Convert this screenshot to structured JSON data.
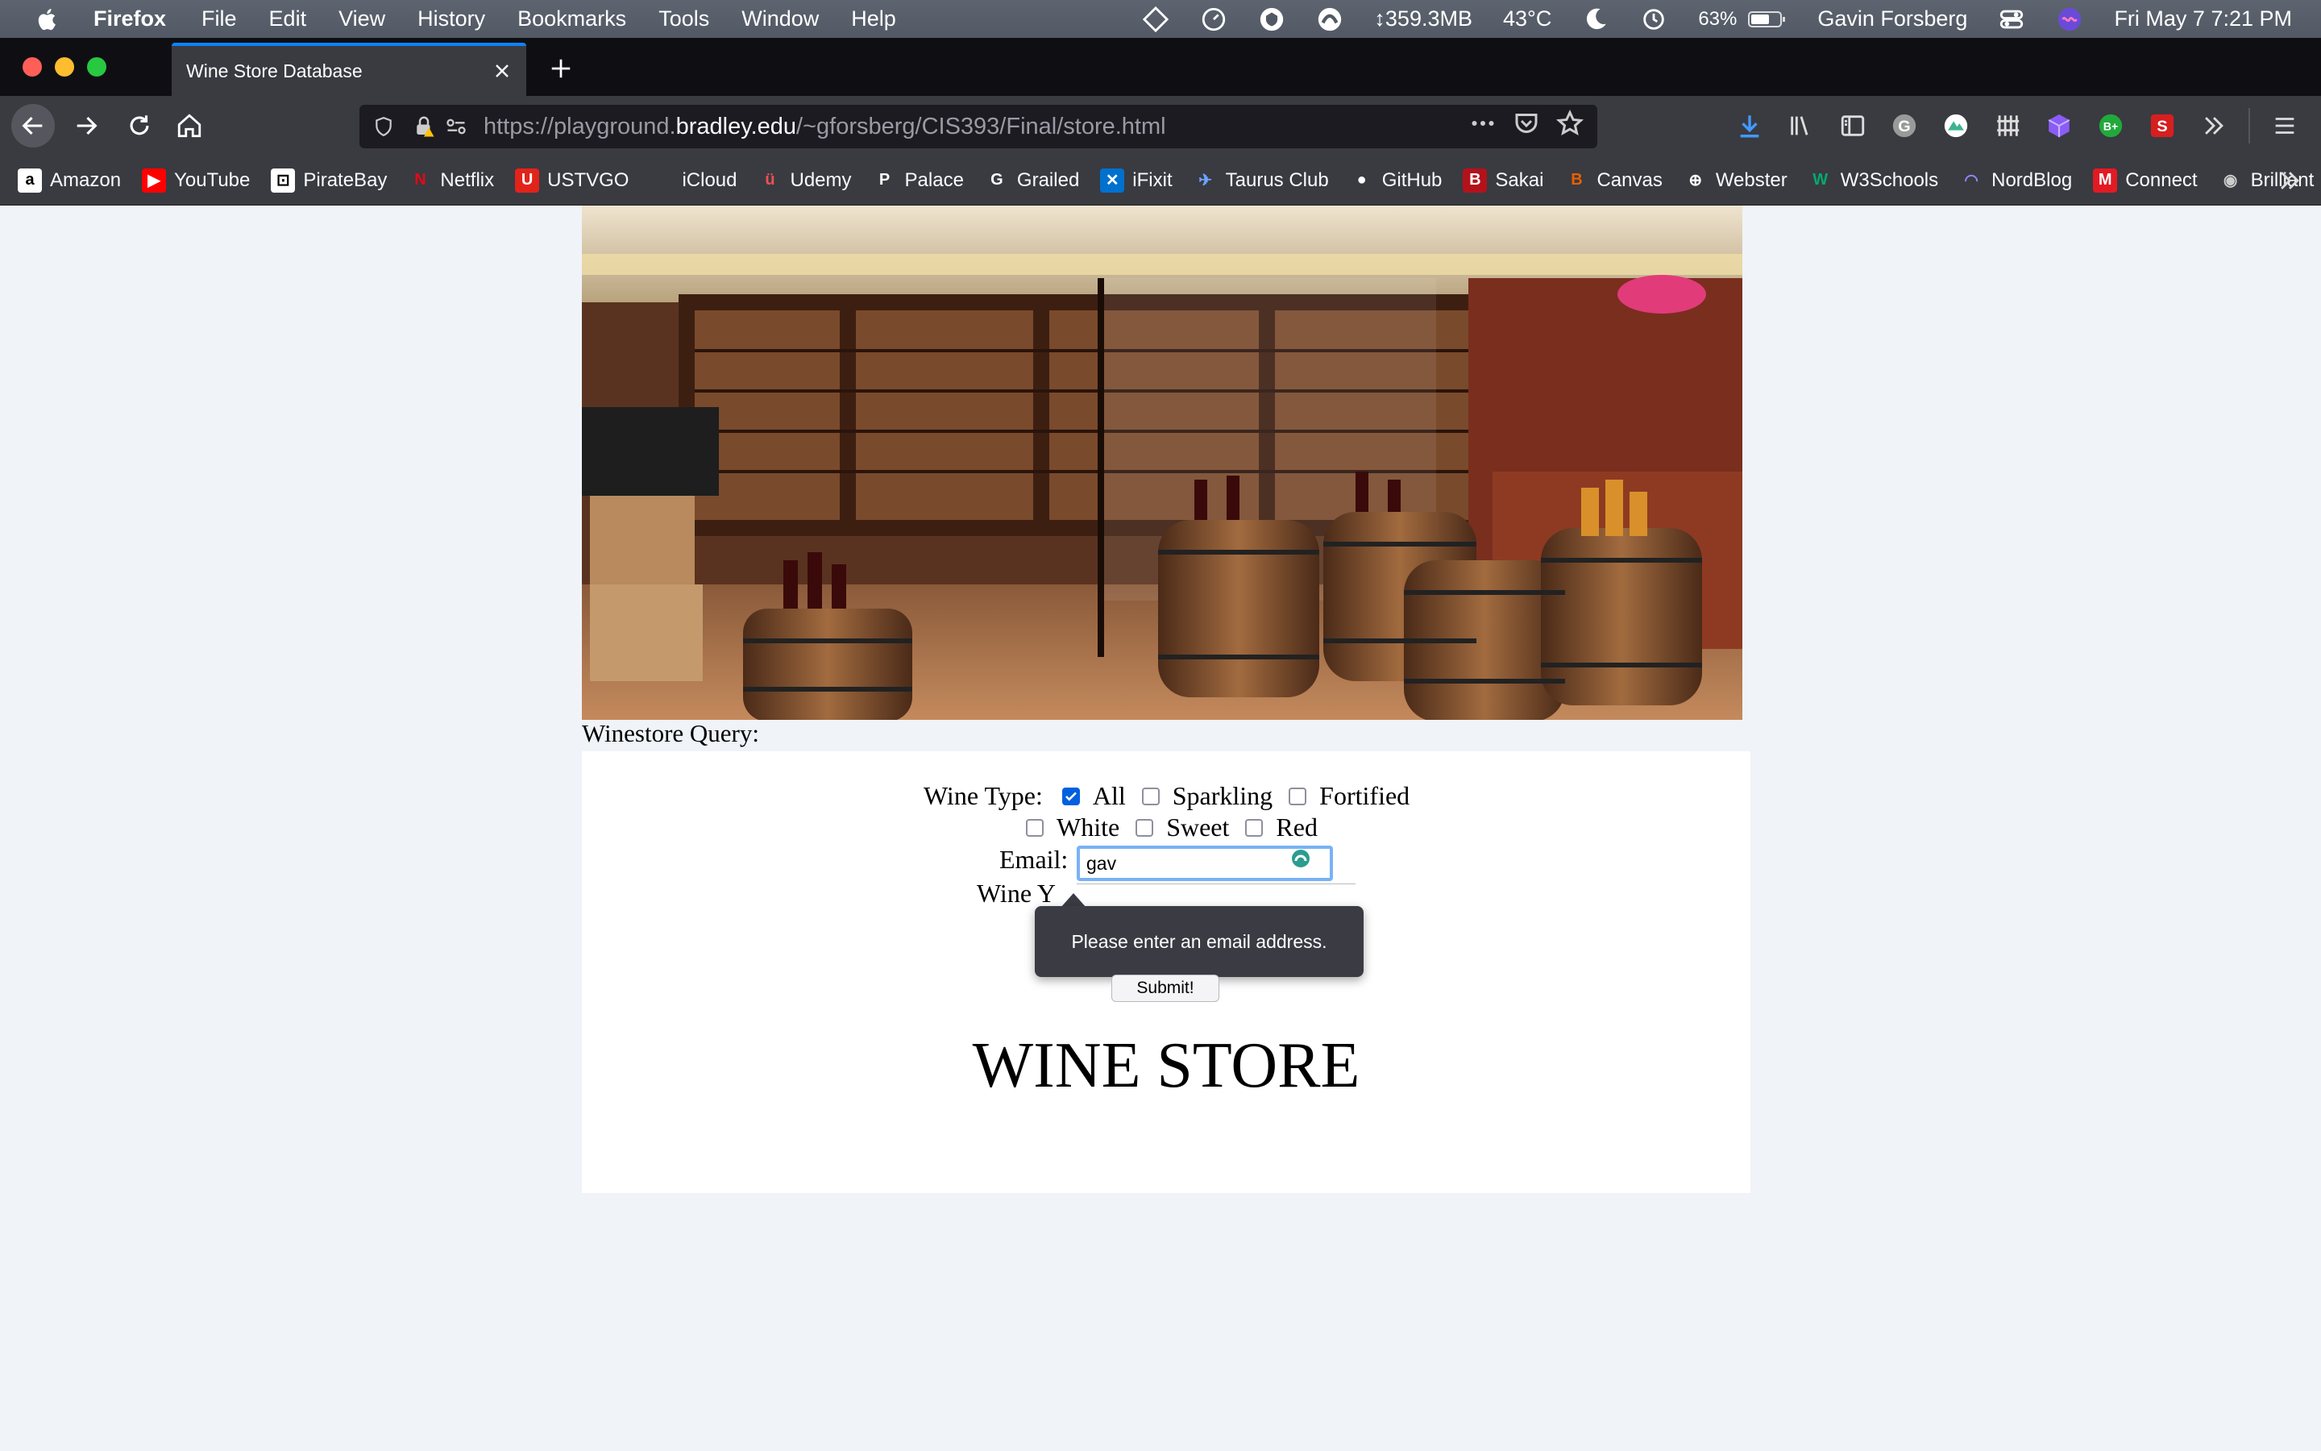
{
  "menubar": {
    "app_name": "Firefox",
    "items": [
      "File",
      "Edit",
      "View",
      "History",
      "Bookmarks",
      "Tools",
      "Window",
      "Help"
    ],
    "status": {
      "memory": "↕359.3MB",
      "temperature": "43°C",
      "battery": "63%",
      "user": "Gavin Forsberg",
      "datetime": "Fri May 7  7:21 PM"
    }
  },
  "tab": {
    "title": "Wine Store Database"
  },
  "url": {
    "prefix": "https://playground.",
    "domain": "bradley.edu",
    "path": "/~gforsberg/CIS393/Final/store.html"
  },
  "bookmarks": [
    {
      "label": "Amazon",
      "icon": "amazon-icon",
      "color": "#ffffff",
      "glyph": "a",
      "fg": "#000000"
    },
    {
      "label": "YouTube",
      "icon": "youtube-icon",
      "color": "#ff0000",
      "glyph": "▶",
      "fg": "#ffffff"
    },
    {
      "label": "PirateBay",
      "icon": "piratebay-icon",
      "color": "#ffffff",
      "glyph": "⊡",
      "fg": "#000000"
    },
    {
      "label": "Netflix",
      "icon": "netflix-icon",
      "color": "#3a3a41",
      "glyph": "N",
      "fg": "#e50914"
    },
    {
      "label": "USTVGO",
      "icon": "ustvgo-icon",
      "color": "#e2231a",
      "glyph": "U",
      "fg": "#ffffff"
    },
    {
      "label": "iCloud",
      "icon": "icloud-icon",
      "color": "#3a3a41",
      "glyph": "",
      "fg": "#cccccc"
    },
    {
      "label": "Udemy",
      "icon": "udemy-icon",
      "color": "#3a3a41",
      "glyph": "ü",
      "fg": "#ec5252"
    },
    {
      "label": "Palace",
      "icon": "palace-icon",
      "color": "#3a3a41",
      "glyph": "P",
      "fg": "#ffffff"
    },
    {
      "label": "Grailed",
      "icon": "grailed-icon",
      "color": "#3a3a41",
      "glyph": "G",
      "fg": "#ffffff"
    },
    {
      "label": "iFixit",
      "icon": "ifixit-icon",
      "color": "#0071ce",
      "glyph": "✕",
      "fg": "#ffffff"
    },
    {
      "label": "Taurus Club",
      "icon": "taurus-icon",
      "color": "#3a3a41",
      "glyph": "✈",
      "fg": "#6aa6ff"
    },
    {
      "label": "GitHub",
      "icon": "github-icon",
      "color": "#3a3a41",
      "glyph": "●",
      "fg": "#ffffff"
    },
    {
      "label": "Sakai",
      "icon": "sakai-icon",
      "color": "#b3121b",
      "glyph": "B",
      "fg": "#ffffff"
    },
    {
      "label": "Canvas",
      "icon": "canvas-icon",
      "color": "#3a3a41",
      "glyph": "B",
      "fg": "#e66000"
    },
    {
      "label": "Webster",
      "icon": "webster-icon",
      "color": "#3a3a41",
      "glyph": "⊕",
      "fg": "#ffffff"
    },
    {
      "label": "W3Schools",
      "icon": "w3schools-icon",
      "color": "#3a3a41",
      "glyph": "W",
      "fg": "#04aa6d"
    },
    {
      "label": "NordBlog",
      "icon": "nordblog-icon",
      "color": "#3a3a41",
      "glyph": "◠",
      "fg": "#8b8bff"
    },
    {
      "label": "Connect",
      "icon": "connect-icon",
      "color": "#e21a23",
      "glyph": "M",
      "fg": "#ffffff"
    },
    {
      "label": "Brilliant",
      "icon": "brilliant-icon",
      "color": "#3a3a41",
      "glyph": "◉",
      "fg": "#cccccc"
    }
  ],
  "page": {
    "query_label": "Winestore Query:",
    "wine_type_label": "Wine Type:",
    "wine_types": [
      {
        "label": "All",
        "checked": true
      },
      {
        "label": "Sparkling",
        "checked": false
      },
      {
        "label": "Fortified",
        "checked": false
      },
      {
        "label": "White",
        "checked": false
      },
      {
        "label": "Sweet",
        "checked": false
      },
      {
        "label": "Red",
        "checked": false
      }
    ],
    "email_label": "Email:",
    "email_value": "gav",
    "wine_year_label": "Wine Y",
    "validation_message": "Please enter an email address.",
    "submit_label": "Submit!",
    "heading": "WINE STORE"
  },
  "colors": {
    "accent": "#0a84ff",
    "checkbox_checked": "#0060df",
    "focus_ring": "#79b2f5"
  }
}
